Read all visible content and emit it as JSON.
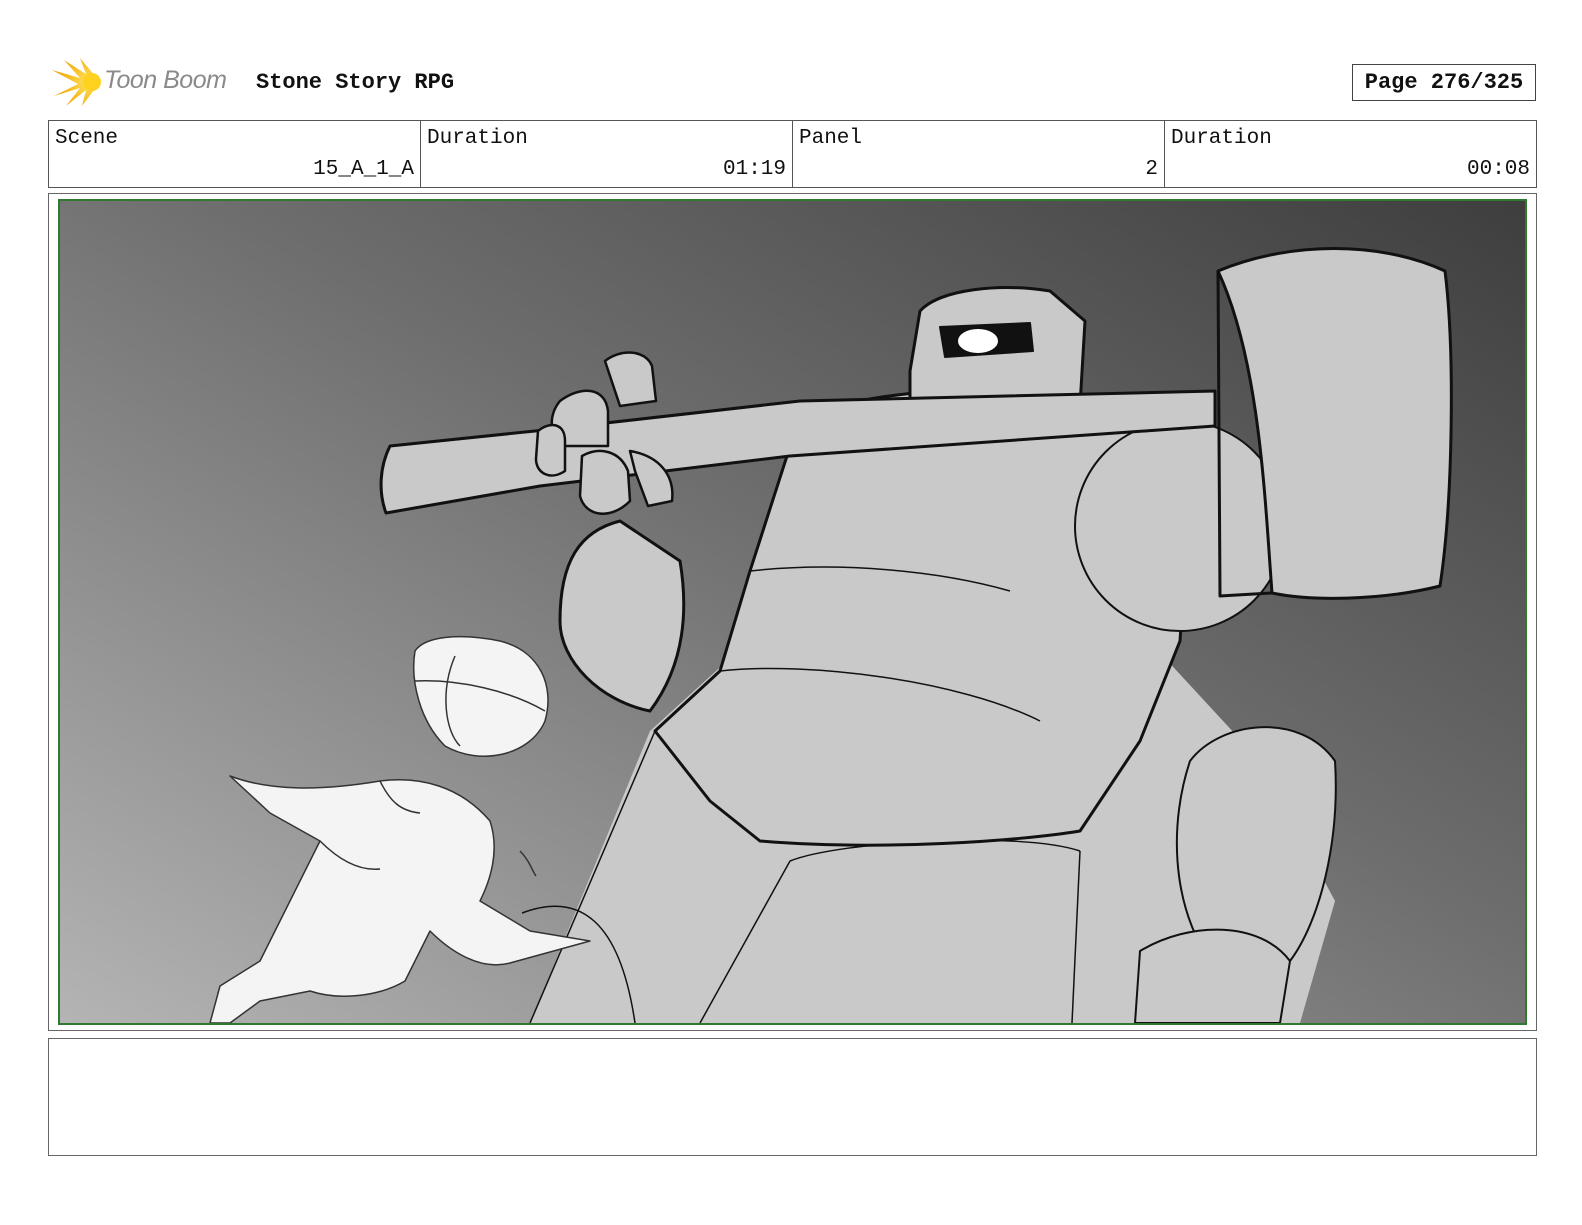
{
  "header": {
    "logo_text": "Toon Boom",
    "project_title": "Stone Story RPG",
    "page_label": "Page 276/325"
  },
  "info": {
    "scene_label": "Scene",
    "scene_value": "15_A_1_A",
    "scene_duration_label": "Duration",
    "scene_duration_value": "01:19",
    "panel_label": "Panel",
    "panel_value": "2",
    "panel_duration_label": "Duration",
    "panel_duration_value": "00:08"
  },
  "notes": {
    "text": ""
  },
  "colors": {
    "logo_accent": "#f5b800",
    "safe_frame": "#2f7a2f",
    "sketch_fill": "#c9c9c9"
  }
}
